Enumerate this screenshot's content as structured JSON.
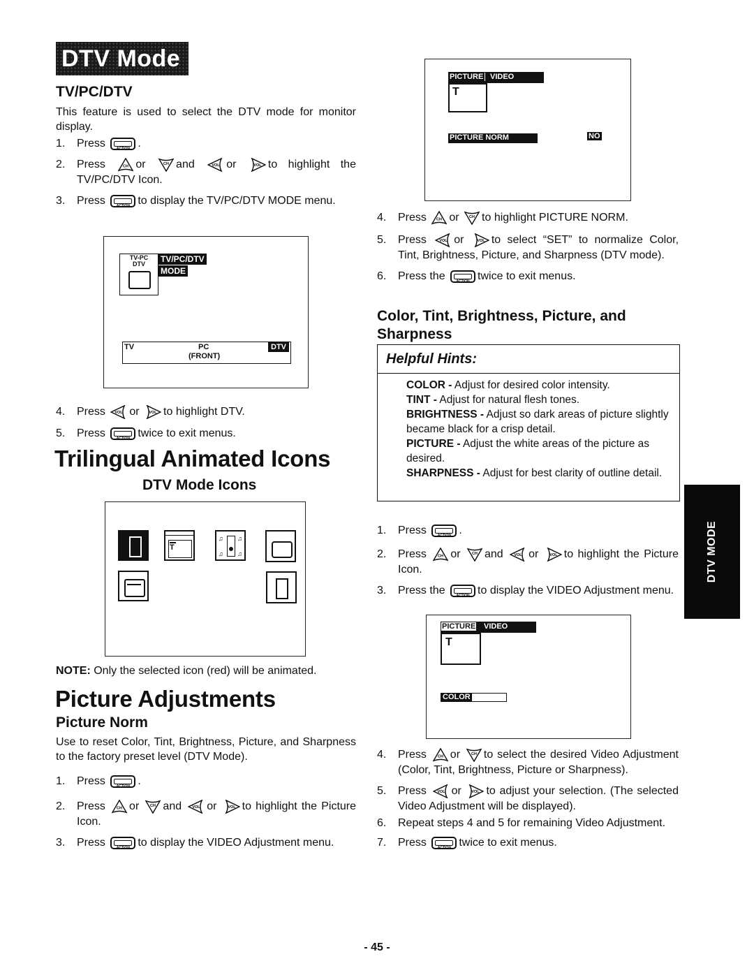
{
  "banner": {
    "title": "DTV Mode"
  },
  "tvpcdtv": {
    "heading": "TV/PC/DTV",
    "intro": "This feature is used to select the DTV mode for monitor display.",
    "steps": [
      {
        "num": "1.",
        "pre": "Press",
        "post": "."
      },
      {
        "num": "2.",
        "pre": "Press",
        "mid1": "or",
        "mid2": "and",
        "mid3": "or",
        "post": "to highlight the TV/PC/DTV Icon."
      },
      {
        "num": "3.",
        "pre": "Press",
        "post": "to display the TV/PC/DTV MODE menu."
      }
    ],
    "screen": {
      "icon_label_top": "TV-PC",
      "icon_label_bottom": "DTV",
      "menu_title_1": "TV/PC/DTV",
      "menu_title_2": "MODE",
      "options": [
        "TV",
        "PC",
        "(FRONT)",
        "DTV"
      ],
      "selected": "DTV"
    },
    "steps2": [
      {
        "num": "4.",
        "pre": "Press",
        "mid1": "or",
        "post": "to highlight DTV."
      },
      {
        "num": "5.",
        "pre": "Press",
        "post": "twice to exit menus."
      }
    ]
  },
  "trilingual": {
    "heading": "Trilingual Animated Icons",
    "subheading": "DTV Mode Icons",
    "icons": [
      "exit-door-icon-selected",
      "picture-icon",
      "audio-speaker-icon",
      "tv-pc-dtv-icon",
      "setup-icon",
      "exit-door-icon"
    ],
    "note_label": "NOTE:",
    "note_text": "Only the selected icon (red) will be animated."
  },
  "picture_adjustments": {
    "heading": "Picture Adjustments",
    "norm_heading": "Picture Norm",
    "norm_intro": "Use to reset Color, Tint, Brightness, Picture, and Sharpness to the factory preset level (DTV Mode).",
    "steps": [
      {
        "num": "1.",
        "pre": "Press",
        "post": "."
      },
      {
        "num": "2.",
        "pre": "Press",
        "mid1": "or",
        "mid2": "and",
        "mid3": "or",
        "post": "to highlight the Picture Icon."
      },
      {
        "num": "3.",
        "pre": "Press",
        "post": "to display the VIDEO Adjustment menu."
      }
    ],
    "screen1": {
      "tab1": "PICTURE",
      "tab2": "VIDEO",
      "item": "PICTURE NORM",
      "value": "NO"
    },
    "steps_right": [
      {
        "num": "4.",
        "pre": "Press",
        "mid1": "or",
        "post": "to highlight PICTURE NORM."
      },
      {
        "num": "5.",
        "pre": "Press",
        "mid1": "or",
        "post": "to select “SET” to normalize Color, Tint, Brightness, Picture, and Sharpness (DTV mode)."
      },
      {
        "num": "6.",
        "pre": "Press the",
        "post": "twice to exit menus."
      }
    ],
    "cat_heading": "Color, Tint, Brightness, Picture, and Sharpness",
    "hints_title": "Helpful Hints:",
    "hints": [
      {
        "term": "COLOR -",
        "desc": "Adjust for desired color intensity."
      },
      {
        "term": "TINT -",
        "desc": "Adjust for natural flesh tones."
      },
      {
        "term": "BRIGHTNESS -",
        "desc": "Adjust so dark areas of picture slightly became black for a crisp detail."
      },
      {
        "term": "PICTURE -",
        "desc": "Adjust the white areas of the picture as desired."
      },
      {
        "term": "SHARPNESS -",
        "desc": "Adjust for best clarity of outline detail."
      }
    ],
    "steps_video": [
      {
        "num": "1.",
        "pre": "Press",
        "post": "."
      },
      {
        "num": "2.",
        "pre": "Press",
        "mid1": "or",
        "mid2": "and",
        "mid3": "or",
        "post": "to highlight the Picture Icon."
      },
      {
        "num": "3.",
        "pre": "Press the",
        "post": "to display the VIDEO Adjustment menu."
      }
    ],
    "screen2": {
      "tab1": "PICTURE",
      "tab2": "VIDEO",
      "item": "COLOR"
    },
    "steps_video2": [
      {
        "num": "4.",
        "pre": "Press",
        "mid1": "or",
        "post": "to select the desired Video Adjustment (Color, Tint, Brightness, Picture or Sharpness)."
      },
      {
        "num": "5.",
        "pre": "Press",
        "mid1": "or",
        "post": "to adjust your selection. (The selected Video Adjustment will be displayed)."
      },
      {
        "num": "6.",
        "pre": "Repeat steps 4 and 5 for remaining Video Adjustment."
      },
      {
        "num": "7.",
        "pre": "Press",
        "post": "twice to exit menus."
      }
    ]
  },
  "buttons": {
    "action": "ACTION",
    "ch": "CH",
    "vol": "VOL"
  },
  "side_tab": "DTV MODE",
  "page_number": "- 45 -"
}
